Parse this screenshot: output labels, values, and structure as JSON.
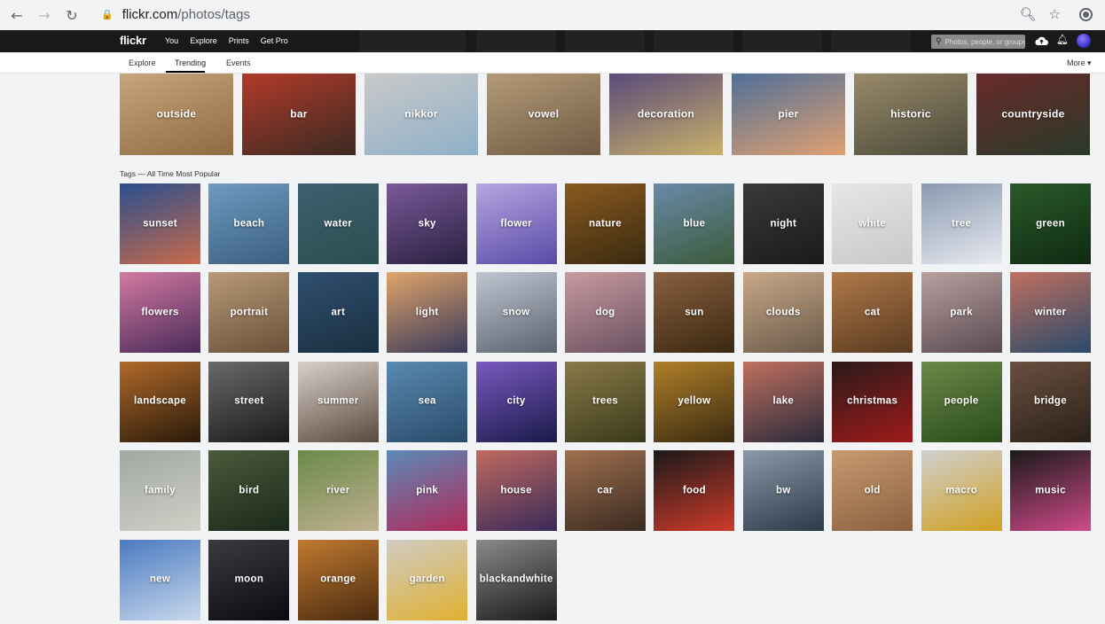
{
  "browser": {
    "url_domain": "flickr.com",
    "url_path": "/photos/tags"
  },
  "flickr": {
    "logo": "flickr",
    "nav": [
      "You",
      "Explore",
      "Prints",
      "Get Pro"
    ],
    "search_placeholder": "Photos, people, or groups"
  },
  "subnav": {
    "tabs": [
      "Explore",
      "Trending",
      "Events"
    ],
    "active": "Trending",
    "more": "More ▾"
  },
  "trending_tags": [
    {
      "label": "outside",
      "colors": [
        "#c8a57a",
        "#8f6a43"
      ]
    },
    {
      "label": "bar",
      "colors": [
        "#b23a2a",
        "#3b2a22"
      ]
    },
    {
      "label": "nikkor",
      "colors": [
        "#c9c9c9",
        "#8fb0c8"
      ]
    },
    {
      "label": "vowel",
      "colors": [
        "#b49a78",
        "#6f5b43"
      ]
    },
    {
      "label": "decoration",
      "colors": [
        "#5a4a7a",
        "#c8b06a"
      ]
    },
    {
      "label": "pier",
      "colors": [
        "#4f6f99",
        "#e0a070"
      ]
    },
    {
      "label": "historic",
      "colors": [
        "#9a8a6a",
        "#4a4a3a"
      ]
    },
    {
      "label": "countryside",
      "colors": [
        "#6a2a2a",
        "#2a3a2a"
      ]
    }
  ],
  "section_title": "Tags — All Time Most Popular",
  "popular_tags": [
    {
      "label": "sunset",
      "colors": [
        "#2a4f8f",
        "#c86a4a"
      ]
    },
    {
      "label": "beach",
      "colors": [
        "#6f9ac0",
        "#3a5f7f"
      ]
    },
    {
      "label": "water",
      "colors": [
        "#3f5f6f",
        "#2a4f4f"
      ]
    },
    {
      "label": "sky",
      "colors": [
        "#7a5a9a",
        "#2a2040"
      ]
    },
    {
      "label": "flower",
      "colors": [
        "#b6a6e0",
        "#5a4aa8"
      ]
    },
    {
      "label": "nature",
      "colors": [
        "#8a5a20",
        "#3a2a10"
      ]
    },
    {
      "label": "blue",
      "colors": [
        "#6a8aaa",
        "#3a5a3a"
      ]
    },
    {
      "label": "night",
      "colors": [
        "#3a3a3a",
        "#1a1a1a"
      ]
    },
    {
      "label": "white",
      "colors": [
        "#e6e6e6",
        "#c8c8c8"
      ]
    },
    {
      "label": "tree",
      "colors": [
        "#8a9ab0",
        "#e8eaf0"
      ]
    },
    {
      "label": "green",
      "colors": [
        "#2a5a2a",
        "#0f2a12"
      ]
    },
    {
      "label": "flowers",
      "colors": [
        "#d27aa0",
        "#4a2a5a"
      ]
    },
    {
      "label": "portrait",
      "colors": [
        "#b89a78",
        "#6a5038"
      ]
    },
    {
      "label": "art",
      "colors": [
        "#2f4f6f",
        "#1a2f3f"
      ]
    },
    {
      "label": "light",
      "colors": [
        "#e0a46a",
        "#3a3a5a"
      ]
    },
    {
      "label": "snow",
      "colors": [
        "#c0c6d0",
        "#5a6270"
      ]
    },
    {
      "label": "dog",
      "colors": [
        "#c89aa0",
        "#6a5060"
      ]
    },
    {
      "label": "sun",
      "colors": [
        "#8a6040",
        "#3a2810"
      ]
    },
    {
      "label": "clouds",
      "colors": [
        "#c8a888",
        "#6a5a4a"
      ]
    },
    {
      "label": "cat",
      "colors": [
        "#b07a4a",
        "#5a3a20"
      ]
    },
    {
      "label": "park",
      "colors": [
        "#b8a0a0",
        "#5a4a50"
      ]
    },
    {
      "label": "winter",
      "colors": [
        "#c07060",
        "#2a4a6a"
      ]
    },
    {
      "label": "landscape",
      "colors": [
        "#b06a2a",
        "#2a1a0a"
      ]
    },
    {
      "label": "street",
      "colors": [
        "#6a6a6a",
        "#1a1a1a"
      ]
    },
    {
      "label": "summer",
      "colors": [
        "#d8d0c8",
        "#5a4a40"
      ]
    },
    {
      "label": "sea",
      "colors": [
        "#5a8ab0",
        "#2a4a6a"
      ]
    },
    {
      "label": "city",
      "colors": [
        "#7a5ac0",
        "#1a1a4a"
      ]
    },
    {
      "label": "trees",
      "colors": [
        "#8a7a4a",
        "#3a3a1a"
      ]
    },
    {
      "label": "yellow",
      "colors": [
        "#b0802a",
        "#3a2a10"
      ]
    },
    {
      "label": "lake",
      "colors": [
        "#c07060",
        "#2a2a3a"
      ]
    },
    {
      "label": "christmas",
      "colors": [
        "#2a1a1a",
        "#a01a1a"
      ]
    },
    {
      "label": "people",
      "colors": [
        "#6a8a4a",
        "#2a4a1a"
      ]
    },
    {
      "label": "bridge",
      "colors": [
        "#6a5040",
        "#2a2018"
      ]
    },
    {
      "label": "family",
      "colors": [
        "#a0a8a0",
        "#d0d0c8"
      ]
    },
    {
      "label": "bird",
      "colors": [
        "#4a5a3a",
        "#1a2a1a"
      ]
    },
    {
      "label": "river",
      "colors": [
        "#6a8a4a",
        "#c0b090"
      ]
    },
    {
      "label": "pink",
      "colors": [
        "#5a8ab8",
        "#b02a5a"
      ]
    },
    {
      "label": "house",
      "colors": [
        "#c06a60",
        "#3a2a5a"
      ]
    },
    {
      "label": "car",
      "colors": [
        "#a07050",
        "#3a2a20"
      ]
    },
    {
      "label": "food",
      "colors": [
        "#1a1a1a",
        "#d03a2a"
      ]
    },
    {
      "label": "bw",
      "colors": [
        "#8a9aa8",
        "#2a3a48"
      ]
    },
    {
      "label": "old",
      "colors": [
        "#c89a70",
        "#8a6040"
      ]
    },
    {
      "label": "macro",
      "colors": [
        "#d0d0d0",
        "#d0a020"
      ]
    },
    {
      "label": "music",
      "colors": [
        "#1a1a1a",
        "#d04a8a"
      ]
    },
    {
      "label": "new",
      "colors": [
        "#4a7ac0",
        "#c8d8ec"
      ]
    },
    {
      "label": "moon",
      "colors": [
        "#3a3a40",
        "#0a0a10"
      ]
    },
    {
      "label": "orange",
      "colors": [
        "#c07a30",
        "#4a2a10"
      ]
    },
    {
      "label": "garden",
      "colors": [
        "#d0ccc4",
        "#e0b030"
      ]
    },
    {
      "label": "blackandwhite",
      "colors": [
        "#8a8a8a",
        "#1a1a1a"
      ]
    }
  ]
}
